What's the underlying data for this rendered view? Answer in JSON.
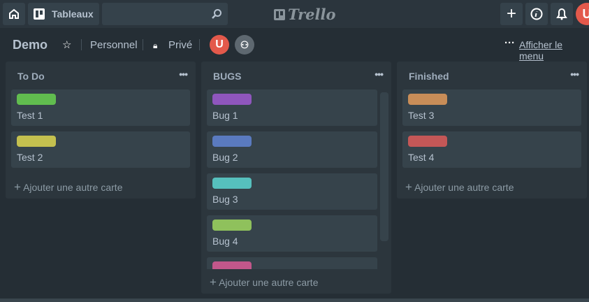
{
  "topbar": {
    "boards_label": "Tableaux",
    "search_placeholder": "",
    "logo_text": "Trello",
    "avatar_initial": "U"
  },
  "board": {
    "title": "Demo",
    "visibility_team": "Personnel",
    "privacy": "Privé",
    "menu_label": "Afficher le menu",
    "member_initial": "U"
  },
  "lists": [
    {
      "title": "To Do",
      "add_label": "Ajouter une autre carte",
      "cards": [
        {
          "title": "Test 1",
          "label_color": "#61bd4f"
        },
        {
          "title": "Test 2",
          "label_color": "#c4c04f"
        }
      ]
    },
    {
      "title": "BUGS",
      "add_label": "Ajouter une autre carte",
      "cards": [
        {
          "title": "Bug 1",
          "label_color": "#8f56bd"
        },
        {
          "title": "Bug 2",
          "label_color": "#5a7abf"
        },
        {
          "title": "Bug 3",
          "label_color": "#56c0bd"
        },
        {
          "title": "Bug 4",
          "label_color": "#8fc15c"
        },
        {
          "title": "",
          "label_color": "#c2578b"
        }
      ]
    },
    {
      "title": "Finished",
      "add_label": "Ajouter une autre carte",
      "cards": [
        {
          "title": "Test 3",
          "label_color": "#c88d58"
        },
        {
          "title": "Test 4",
          "label_color": "#c45757"
        }
      ]
    }
  ]
}
